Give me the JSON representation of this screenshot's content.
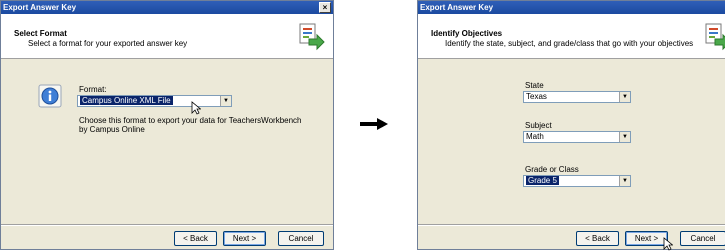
{
  "left": {
    "window_title": "Export Answer Key",
    "close_glyph": "×",
    "header_title": "Select Format",
    "header_subtitle": "Select a format for your exported answer key",
    "format_label": "Format:",
    "format_value": "Campus Online XML File",
    "description": "Choose this format to export your data for TeachersWorkbench by Campus Online",
    "back_label": "< Back",
    "next_label": "Next >",
    "cancel_label": "Cancel"
  },
  "right": {
    "window_title": "Export Answer Key",
    "header_title": "Identify Objectives",
    "header_subtitle": "Identify the state, subject, and grade/class that go with your objectives",
    "state_label": "State",
    "state_value": "Texas",
    "subject_label": "Subject",
    "subject_value": "Math",
    "grade_label": "Grade or Class",
    "grade_value": "Grade 5",
    "back_label": "< Back",
    "next_label": "Next >",
    "cancel_label": "Cancel"
  },
  "icons": {
    "header_icon": "export-wizard-icon",
    "info_icon": "info-icon",
    "flow_arrow": "arrow-right-icon",
    "cursor": "mouse-cursor-icon"
  },
  "colors": {
    "titlebar": "#1b4aa0",
    "dialog_bg": "#ece9d8",
    "selection": "#0a246a"
  }
}
